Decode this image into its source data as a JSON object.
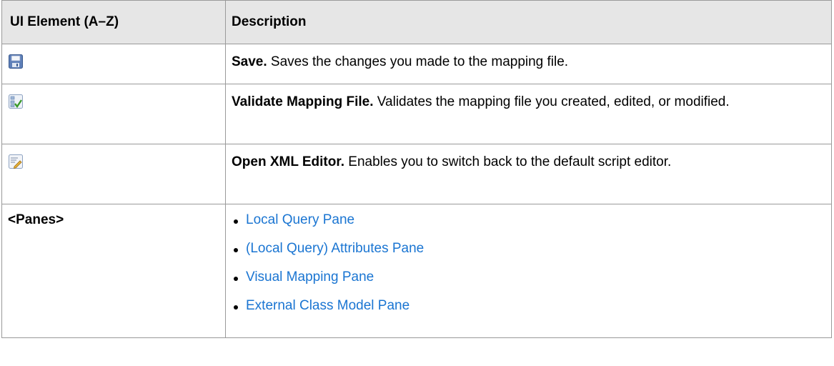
{
  "header": {
    "col1": "UI Element (A–Z)",
    "col2": "Description"
  },
  "rows": [
    {
      "icon": "save-icon",
      "term": "Save.",
      "text": " Saves the changes you made to the mapping file."
    },
    {
      "icon": "validate-mapping-file-icon",
      "term": "Validate Mapping File.",
      "text": " Validates the mapping file you created, edited, or modified."
    },
    {
      "icon": "open-xml-editor-icon",
      "term": "Open XML Editor.",
      "text": " Enables you to switch back to the default script editor."
    }
  ],
  "panes": {
    "label": "<Panes>",
    "links": [
      "Local Query Pane",
      "(Local Query) Attributes Pane",
      "Visual Mapping Pane",
      "External Class Model Pane"
    ]
  },
  "colors": {
    "header_bg": "#e6e6e6",
    "border": "#9a9a9a",
    "link": "#1a75d2"
  }
}
